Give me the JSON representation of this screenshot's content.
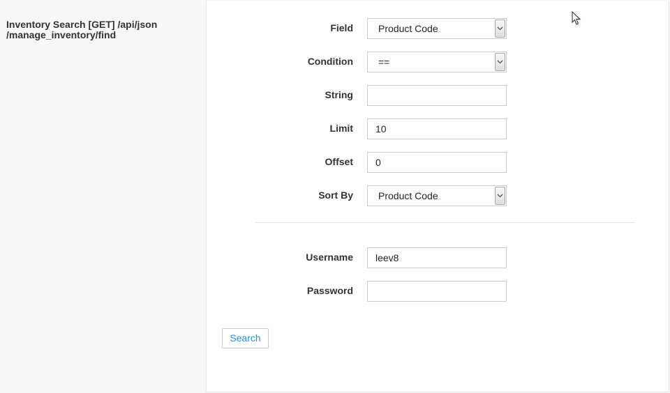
{
  "sidebar": {
    "title_line1": "Inventory Search [GET] /api/json",
    "title_line2": "/manage_inventory/find"
  },
  "form": {
    "field": {
      "label": "Field",
      "value": "Product Code"
    },
    "condition": {
      "label": "Condition",
      "value": "=="
    },
    "string": {
      "label": "String",
      "value": ""
    },
    "limit": {
      "label": "Limit",
      "value": "10"
    },
    "offset": {
      "label": "Offset",
      "value": "0"
    },
    "sort_by": {
      "label": "Sort By",
      "value": "Product Code"
    },
    "username": {
      "label": "Username",
      "value": "leev8"
    },
    "password": {
      "label": "Password",
      "value": ""
    },
    "search_label": "Search"
  },
  "colors": {
    "accent_link": "#2a8fd6",
    "sidebar_bg": "#f7f7f7",
    "panel_bg": "#ffffff",
    "border": "#cccccc"
  },
  "icons": [
    "chevron-down-icon",
    "mouse-cursor-icon"
  ]
}
